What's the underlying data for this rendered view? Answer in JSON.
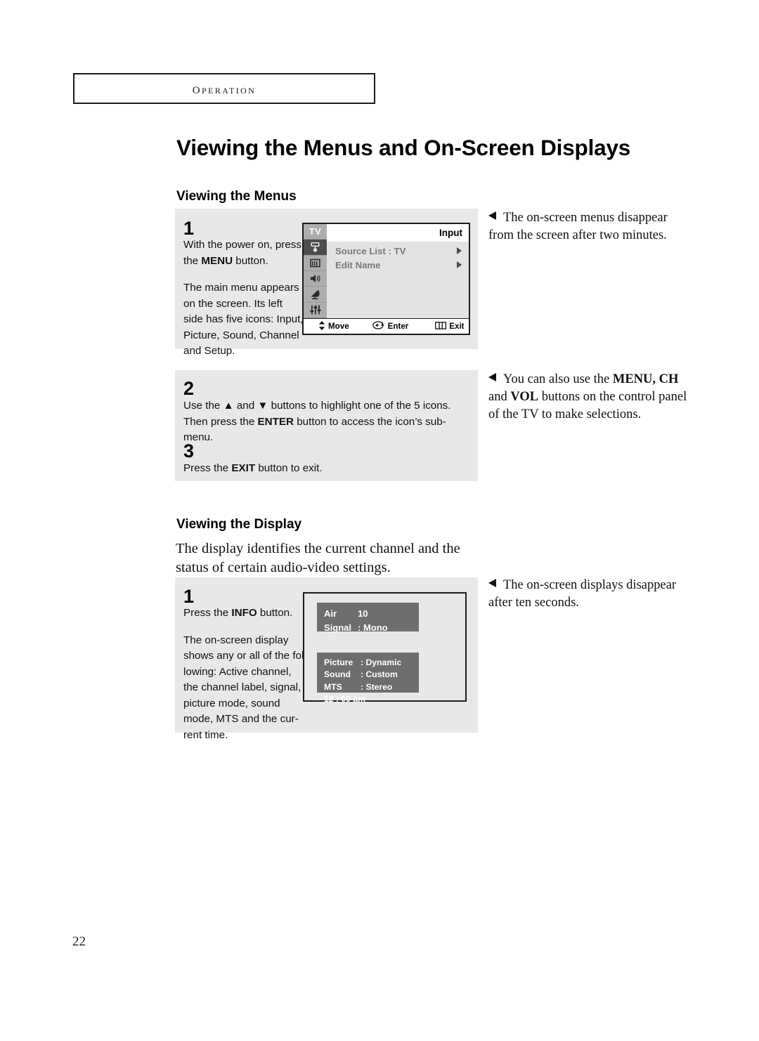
{
  "header": {
    "chapter_label": "Operation"
  },
  "page_title": "Viewing the Menus and On-Screen Displays",
  "sections": {
    "menus_title": "Viewing the Menus",
    "display_title": "Viewing the Display",
    "display_intro": "The display identifies the current channel and the status of certain audio-video settings."
  },
  "steps": {
    "s1_num": "1",
    "s1_p1_a": "With the power on, press the ",
    "s1_p1_b": "MENU",
    "s1_p1_c": " button.",
    "s1_p2": "The main menu appears on the screen. Its left side has five icons: Input, Picture, Sound, Channel and Setup.",
    "s2_num": "2",
    "s2_line1_a": "Use the ",
    "s2_line1_up": "▲",
    "s2_line1_b": " and ",
    "s2_line1_down": "▼",
    "s2_line1_c": " buttons to highlight one of the 5 icons.",
    "s2_line2_a": "Then press the ",
    "s2_line2_b": "ENTER",
    "s2_line2_c": " button to access the icon’s sub-menu.",
    "s3_num": "3",
    "s3_line_a": "Press the ",
    "s3_line_b": "EXIT",
    "s3_line_c": " button to exit.",
    "s4_num": "1",
    "s4_p1_a": "Press the ",
    "s4_p1_b": "INFO",
    "s4_p1_c": " button.",
    "s4_p2": "The on-screen display shows any or all of the fol-lowing:   Active channel, the channel label, signal, picture mode, sound mode, MTS and the cur- rent time."
  },
  "tv_menu": {
    "rail_tv_label": "TV",
    "title": "Input",
    "icons": [
      {
        "name": "input-jack-icon",
        "active": true
      },
      {
        "name": "picture-icon",
        "active": false
      },
      {
        "name": "speaker-icon",
        "active": false
      },
      {
        "name": "satellite-dish-icon",
        "active": false
      },
      {
        "name": "sliders-setup-icon",
        "active": false
      }
    ],
    "rows": [
      {
        "label": "Source List :  TV"
      },
      {
        "label": "Edit Name"
      }
    ],
    "footer": {
      "move": "Move",
      "enter": "Enter",
      "exit": "Exit"
    },
    "colors": {
      "rail": "#adadad",
      "rail_active": "#4d4d4d",
      "body": "#e3e3e3",
      "row_text": "#7a7a7a"
    }
  },
  "osd": {
    "block_a": [
      {
        "key": "Air",
        "value": "10"
      },
      {
        "key": "Signal",
        "value": ": Mono"
      }
    ],
    "block_b": [
      {
        "key": "Picture",
        "value": ": Dynamic"
      },
      {
        "key": "Sound",
        "value": ": Custom"
      },
      {
        "key": "MTS",
        "value": ": Stereo"
      },
      {
        "key": "12 : 00 am",
        "value": ""
      }
    ],
    "colors": {
      "block_bg": "#6e6e6e",
      "screen_bg": "#e8e8e8"
    }
  },
  "notes": {
    "n1": "The on-screen menus disappear from the screen after two minutes.",
    "n2_a": "You can also use the ",
    "n2_b": "MENU, CH",
    "n2_c": " and ",
    "n2_d": "VOL",
    "n2_e": " buttons on the control panel of the TV to make selections.",
    "n3": "The on-screen displays disappear after ten seconds."
  },
  "page_number": "22"
}
